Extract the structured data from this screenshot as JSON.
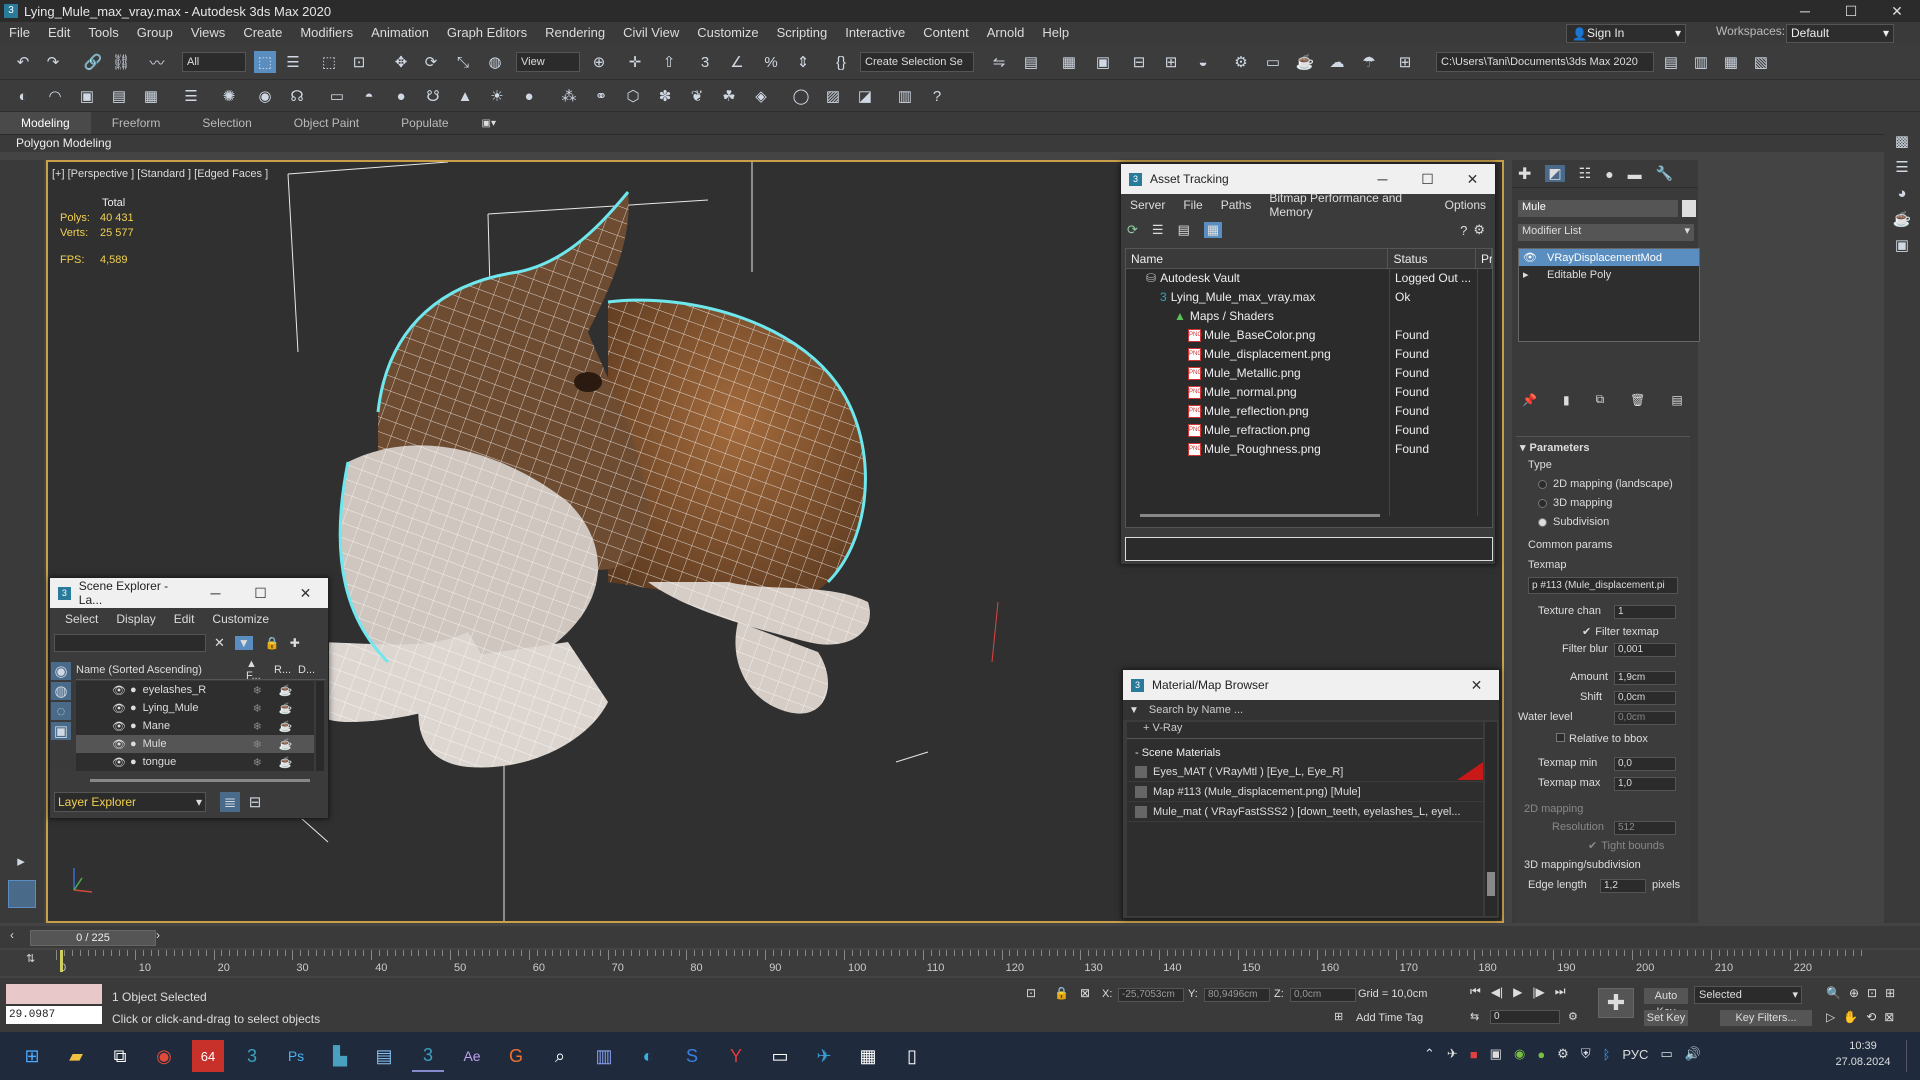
{
  "window": {
    "title": "Lying_Mule_max_vray.max - Autodesk 3ds Max 2020",
    "min": "─",
    "max": "☐",
    "close": "✕"
  },
  "menu": [
    "File",
    "Edit",
    "Tools",
    "Group",
    "Views",
    "Create",
    "Modifiers",
    "Animation",
    "Graph Editors",
    "Rendering",
    "Civil View",
    "Customize",
    "Scripting",
    "Interactive",
    "Content",
    "Arnold",
    "Help"
  ],
  "signin": "Sign In",
  "workspaces_label": "Workspaces:",
  "workspace": "Default",
  "toolbar": {
    "filter": "All",
    "view": "View",
    "selection_set": "Create Selection Se",
    "path": "C:\\Users\\Tani\\Documents\\3ds Max 2020"
  },
  "ribbon": {
    "tabs": [
      "Modeling",
      "Freeform",
      "Selection",
      "Object Paint",
      "Populate"
    ],
    "sub": "Polygon Modeling"
  },
  "viewport": {
    "label": "[+] [Perspective ] [Standard ] [Edged Faces ]",
    "stats": {
      "total": "Total",
      "polys_k": "Polys:",
      "polys": "40 431",
      "verts_k": "Verts:",
      "verts": "25 577",
      "fps_k": "FPS:",
      "fps": "4,589"
    }
  },
  "asset": {
    "title": "Asset Tracking",
    "menu": [
      "Server",
      "File",
      "Paths",
      "Bitmap Performance and Memory",
      "Options"
    ],
    "cols": [
      "Name",
      "Status",
      "Pr"
    ],
    "rows": [
      {
        "name": "Autodesk Vault",
        "status": "Logged Out ...",
        "indent": 1,
        "icon": "vault"
      },
      {
        "name": "Lying_Mule_max_vray.max",
        "status": "Ok",
        "indent": 2,
        "icon": "max"
      },
      {
        "name": "Maps / Shaders",
        "status": "",
        "indent": 3,
        "icon": "maps"
      },
      {
        "name": "Mule_BaseColor.png",
        "status": "Found",
        "indent": 4,
        "icon": "png"
      },
      {
        "name": "Mule_displacement.png",
        "status": "Found",
        "indent": 4,
        "icon": "png"
      },
      {
        "name": "Mule_Metallic.png",
        "status": "Found",
        "indent": 4,
        "icon": "png"
      },
      {
        "name": "Mule_normal.png",
        "status": "Found",
        "indent": 4,
        "icon": "png"
      },
      {
        "name": "Mule_reflection.png",
        "status": "Found",
        "indent": 4,
        "icon": "png"
      },
      {
        "name": "Mule_refraction.png",
        "status": "Found",
        "indent": 4,
        "icon": "png"
      },
      {
        "name": "Mule_Roughness.png",
        "status": "Found",
        "indent": 4,
        "icon": "png"
      }
    ]
  },
  "scene": {
    "title": "Scene Explorer - La...",
    "menu": [
      "Select",
      "Display",
      "Edit",
      "Customize"
    ],
    "header": "Name (Sorted Ascending)",
    "hcols": [
      "▲ F...",
      "R...",
      "D..."
    ],
    "items": [
      "eyelashes_R",
      "Lying_Mule",
      "Mane",
      "Mule",
      "tongue"
    ],
    "selected": "Mule",
    "footer": "Layer Explorer"
  },
  "matb": {
    "title": "Material/Map Browser",
    "search": "Search by Name ...",
    "vray": "+ V-Ray",
    "section": "- Scene Materials",
    "items": [
      "Eyes_MAT  ( VRayMtl )  [Eye_L, Eye_R]",
      "Map #113 (Mule_displacement.png)  [Mule]",
      "Mule_mat  ( VRayFastSSS2 )  [down_teeth, eyelashes_L, eyel..."
    ]
  },
  "cmd": {
    "name": "Mule",
    "modlist": "Modifier List",
    "stack": [
      "VRayDisplacementMod",
      "Editable Poly"
    ],
    "params": "Parameters",
    "type": "Type",
    "types": [
      "2D mapping (landscape)",
      "3D mapping",
      "Subdivision"
    ],
    "type_sel": 2,
    "common": "Common params",
    "texmap": "Texmap",
    "texmap_v": "p #113 (Mule_displacement.pi",
    "texchan_k": "Texture chan",
    "texchan": "1",
    "filter_texmap": "Filter texmap",
    "filterblur_k": "Filter blur",
    "filterblur": "0,001",
    "amount_k": "Amount",
    "amount": "1,9cm",
    "shift_k": "Shift",
    "shift": "0,0cm",
    "water_k": "Water level",
    "water": "0,0cm",
    "relbbox": "Relative to bbox",
    "tmin_k": "Texmap min",
    "tmin": "0,0",
    "tmax_k": "Texmap max",
    "tmax": "1,0",
    "map2d": "2D mapping",
    "res_k": "Resolution",
    "res": "512",
    "tight": "Tight bounds",
    "map3d": "3D mapping/subdivision",
    "edge_k": "Edge length",
    "edge": "1,2",
    "pixels": "pixels"
  },
  "timeline": {
    "frame": "0 / 225",
    "ticks": [
      "0",
      "10",
      "20",
      "30",
      "40",
      "50",
      "60",
      "70",
      "80",
      "90",
      "100",
      "110",
      "120",
      "130",
      "140",
      "150",
      "160",
      "170",
      "180",
      "190",
      "200",
      "210",
      "220"
    ]
  },
  "status": {
    "script_val": "29.0987",
    "selected": "1 Object Selected",
    "hint": "Click or click-and-drag to select objects",
    "x_k": "X:",
    "x": "-25,7053cm",
    "y_k": "Y:",
    "y": "80,9496cm",
    "z_k": "Z:",
    "z": "0,0cm",
    "grid": "Grid = 10,0cm",
    "addtag": "Add Time Tag",
    "autokey": "Auto Key",
    "selected_dd": "Selected",
    "setkey": "Set Key",
    "keyfilters": "Key Filters...",
    "frame_in": "0"
  },
  "taskbar": {
    "lang": "РУС",
    "time": "10:39",
    "date": "27.08.2024",
    "badge": "64"
  }
}
